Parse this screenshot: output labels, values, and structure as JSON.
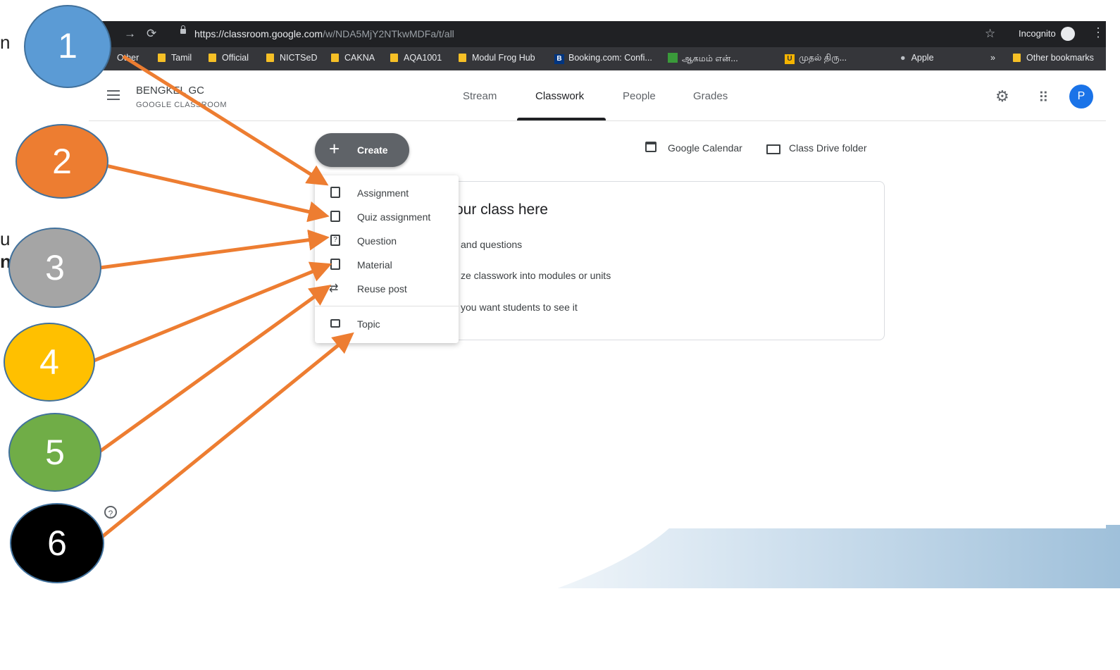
{
  "browser": {
    "url_host": "https://classroom.google.com",
    "url_path": "/w/NDA5MjY2NTkwMDFa/t/all",
    "incognito_label": "Incognito",
    "bookmarks": [
      "Other",
      "Tamil",
      "Official",
      "NICTSeD",
      "CAKNA",
      "AQA1001",
      "Modul Frog Hub",
      "Booking.com: Confi...",
      "ஆகமம் என்...",
      "முதல் திரு...",
      "Apple",
      "»",
      "Other bookmarks"
    ]
  },
  "classroom": {
    "class_name": "BENGKEL GC",
    "class_sub": "GOOGLE CLASSROOM",
    "tabs": [
      "Stream",
      "Classwork",
      "People",
      "Grades"
    ],
    "avatar_letter": "P",
    "create_label": "Create",
    "calendar_label": "Google Calendar",
    "drive_label": "Class Drive folder",
    "card_title": "our class here",
    "card_lines": [
      "and questions",
      "ze classwork into modules or units",
      "you want students to see it"
    ],
    "menu": [
      "Assignment",
      "Quiz assignment",
      "Question",
      "Material",
      "Reuse post",
      "Topic"
    ]
  },
  "slide": {
    "fragments": [
      "n",
      "u",
      "n"
    ],
    "circles": [
      {
        "label": "1",
        "color": "#5b9bd5"
      },
      {
        "label": "2",
        "color": "#ed7d31"
      },
      {
        "label": "3",
        "color": "#a5a5a5"
      },
      {
        "label": "4",
        "color": "#ffc000"
      },
      {
        "label": "5",
        "color": "#70ad47"
      },
      {
        "label": "6",
        "color": "#000000"
      }
    ],
    "arrow_color": "#ed7d31"
  }
}
